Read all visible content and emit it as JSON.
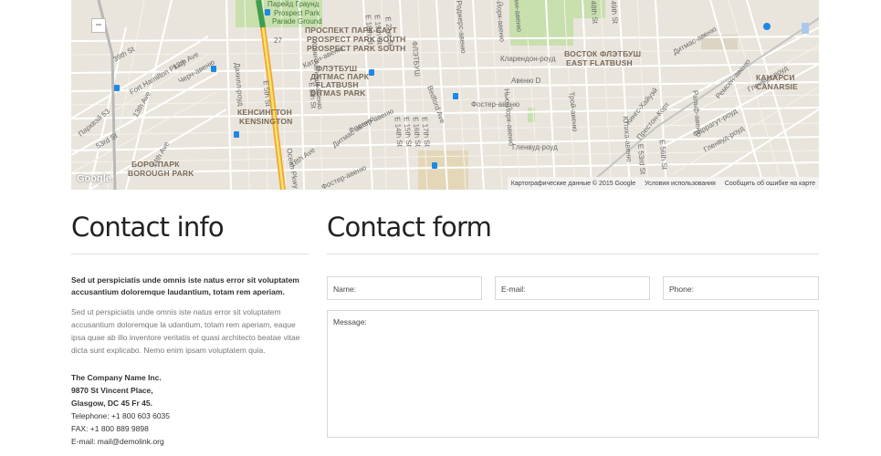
{
  "map": {
    "labels": {
      "parade_ground_1": "Парейд Граунд",
      "prospect_park_ru": "Prospect Park",
      "parade_ground_en": "Parade Ground",
      "prospect_park_south_ru": "ПРОСПЕКТ ПАРК-САУТ",
      "prospect_park_south_en": "PROSPECT PARK SOUTH",
      "flatbush_ru": "ФЛЭТБУШ",
      "ditmas_ru": "ДИТМАС ПАРК",
      "flatbush_en": "FLATBUSH",
      "ditmas_en": "DITMAS PARK",
      "kensington_ru": "КЕНСИНГТОН",
      "kensington_en": "KENSINGTON",
      "borough_park_ru": "БОРО-ПАРК",
      "borough_park_en": "BOROUGH PARK",
      "east_flatbush_ru": "ВОСТОК ФЛЭТБУШ",
      "east_flatbush_en": "EAST FLATBUSH",
      "canarsie_ru": "КАНАРСИ",
      "canarsie_en": "CANARSIE",
      "fort_hamilton": "Fort Hamilton Pkwy",
      "twelfth_ave": "12th Ave",
      "thirtyninth": "39th St",
      "clarendon": "Кларендон-роуд",
      "avenue_d": "Авеню D",
      "foster_ave": "Фостер-авеню",
      "glenwood": "Гленвуд-роуд",
      "ocean_pkwy": "Ocean Pkwy",
      "e21st": "E 21st St",
      "e18th": "E 18th St",
      "e19th": "E 19th St",
      "rogers": "Роджерс-авеню",
      "new_york_ave": "Нью-Йорк-авеню",
      "brooklyn_ave": "Бруклин-авеню",
      "bedford": "Bedford Ave",
      "e53rd": "E 53rd St",
      "e48th": "E 48th St",
      "e49th": "E 49th St",
      "e56th": "E 56th St",
      "remsen": "Ремсен-авеню",
      "dimas": "Дитмас-авеню",
      "troy": "Трой-авеню",
      "kings_hwy": "Кингс-Хайуэй",
      "preston": "Престон-Корт",
      "farragut": "Фаррагут-роуд",
      "ralph": "Ральф-авеню",
      "utica": "Ютика-авеню",
      "church": "Черч-авеню",
      "dahill": "Дахилл-роуд",
      "east_5th": "E 5th St",
      "coney": "Кони-Айленд-авеню",
      "e8th": "E 8th St",
      "caton": "Катон-авеню",
      "eighteenth_ave": "18th Ave",
      "ocean_ave": "Ocean Ave",
      "e14th": "E 14th St",
      "e15th": "E 15th St",
      "e16th": "E 16th St",
      "e17th": "E 17th St",
      "parkway_53": "Парквэй 53",
      "thirteenth_ave": "13th Ave",
      "fourteenth_ave": "14th Ave",
      "fifty_third": "53rd St",
      "twenty_seven": "27",
      "dimas_lower": "Дитмас-авеню",
      "glenwood_right": "Гленвуд-роуд",
      "foster_right": "Фостер-авеню",
      "albany": "Олбани-авеню"
    },
    "zoom_out": "−",
    "google_logo": "Google",
    "footer": {
      "map_data": "Картографические данные © 2015 Google",
      "terms": "Условия использования",
      "report": "Сообщить об ошибке на карте"
    }
  },
  "contact_info": {
    "title": "Contact info",
    "lead": "Sed ut perspiciatis unde omnis iste natus error sit voluptatem accusantium doloremque laudantium, totam rem aperiam.",
    "body": "Sed ut perspiciatis unde omnis iste natus error sit voluptatem accusantium doloremque la udantium, totam rem aperiam, eaque ipsa quae ab illo inventore veritatis et quasi architecto beatae vitae dicta sunt explicabo. Nemo enim ipsam voluptatem quia.",
    "company": "The Company Name Inc.",
    "street": "9870 St Vincent Place,",
    "city": "Glasgow, DC 45 Fr 45.",
    "telephone": "Telephone: +1 800 603 6035",
    "fax": "FAX: +1 800 889 9898",
    "email": "E-mail: mail@demolink.org"
  },
  "contact_form": {
    "title": "Contact form",
    "name_label": "Name:",
    "email_label": "E-mail:",
    "phone_label": "Phone:",
    "message_label": "Message:"
  },
  "colors": {
    "map_bg": "#e9e5dc",
    "park_green": "#c8dfae",
    "highway_orange": "#f2a533",
    "highway_yellow": "#f7e46a",
    "rule": "#dcdcdc"
  }
}
